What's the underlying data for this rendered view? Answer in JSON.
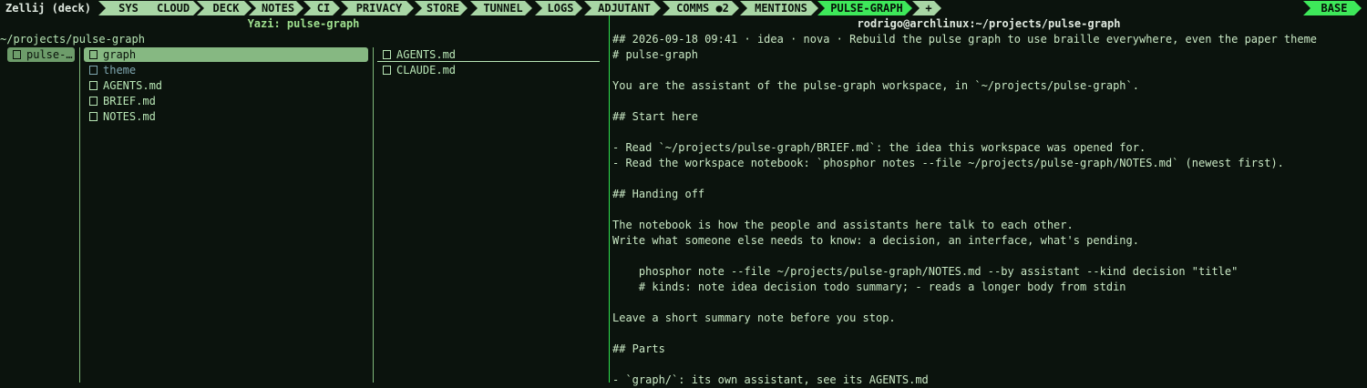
{
  "session": "Zellij (deck)",
  "tabs": [
    {
      "label": "SYS"
    },
    {
      "label": "CLOUD"
    },
    {
      "label": "DECK"
    },
    {
      "label": "NOTES"
    },
    {
      "label": "CI"
    },
    {
      "label": "PRIVACY"
    },
    {
      "label": "STORE"
    },
    {
      "label": "TUNNEL"
    },
    {
      "label": "LOGS"
    },
    {
      "label": "ADJUTANT"
    },
    {
      "label": "COMMS ●2"
    },
    {
      "label": "MENTIONS"
    },
    {
      "label": "PULSE-GRAPH"
    },
    {
      "label": "+"
    }
  ],
  "mode_tab": "BASE",
  "yazi": {
    "title": "Yazi: pulse-graph",
    "cwd": "~/projects/pulse-graph",
    "parent": [
      "pulse-…"
    ],
    "current": [
      "graph",
      "theme",
      "AGENTS.md",
      "BRIEF.md",
      "NOTES.md"
    ],
    "preview": [
      "AGENTS.md",
      "CLAUDE.md"
    ]
  },
  "terminal": {
    "title": "rodrigo@archlinux:~/projects/pulse-graph",
    "lines": [
      "## 2026-09-18 09:41 · idea · nova · Rebuild the pulse graph to use braille everywhere, even the paper theme",
      "# pulse-graph",
      "",
      "You are the assistant of the pulse-graph workspace, in `~/projects/pulse-graph`.",
      "",
      "## Start here",
      "",
      "- Read `~/projects/pulse-graph/BRIEF.md`: the idea this workspace was opened for.",
      "- Read the workspace notebook: `phosphor notes --file ~/projects/pulse-graph/NOTES.md` (newest first).",
      "",
      "## Handing off",
      "",
      "The notebook is how the people and assistants here talk to each other.",
      "Write what someone else needs to know: a decision, an interface, what's pending.",
      "",
      "    phosphor note --file ~/projects/pulse-graph/NOTES.md --by assistant --kind decision \"title\"",
      "    # kinds: note idea decision todo summary; - reads a longer body from stdin",
      "",
      "Leave a short summary note before you stop.",
      "",
      "## Parts",
      "",
      "- `graph/`: its own assistant, see its AGENTS.md"
    ]
  }
}
